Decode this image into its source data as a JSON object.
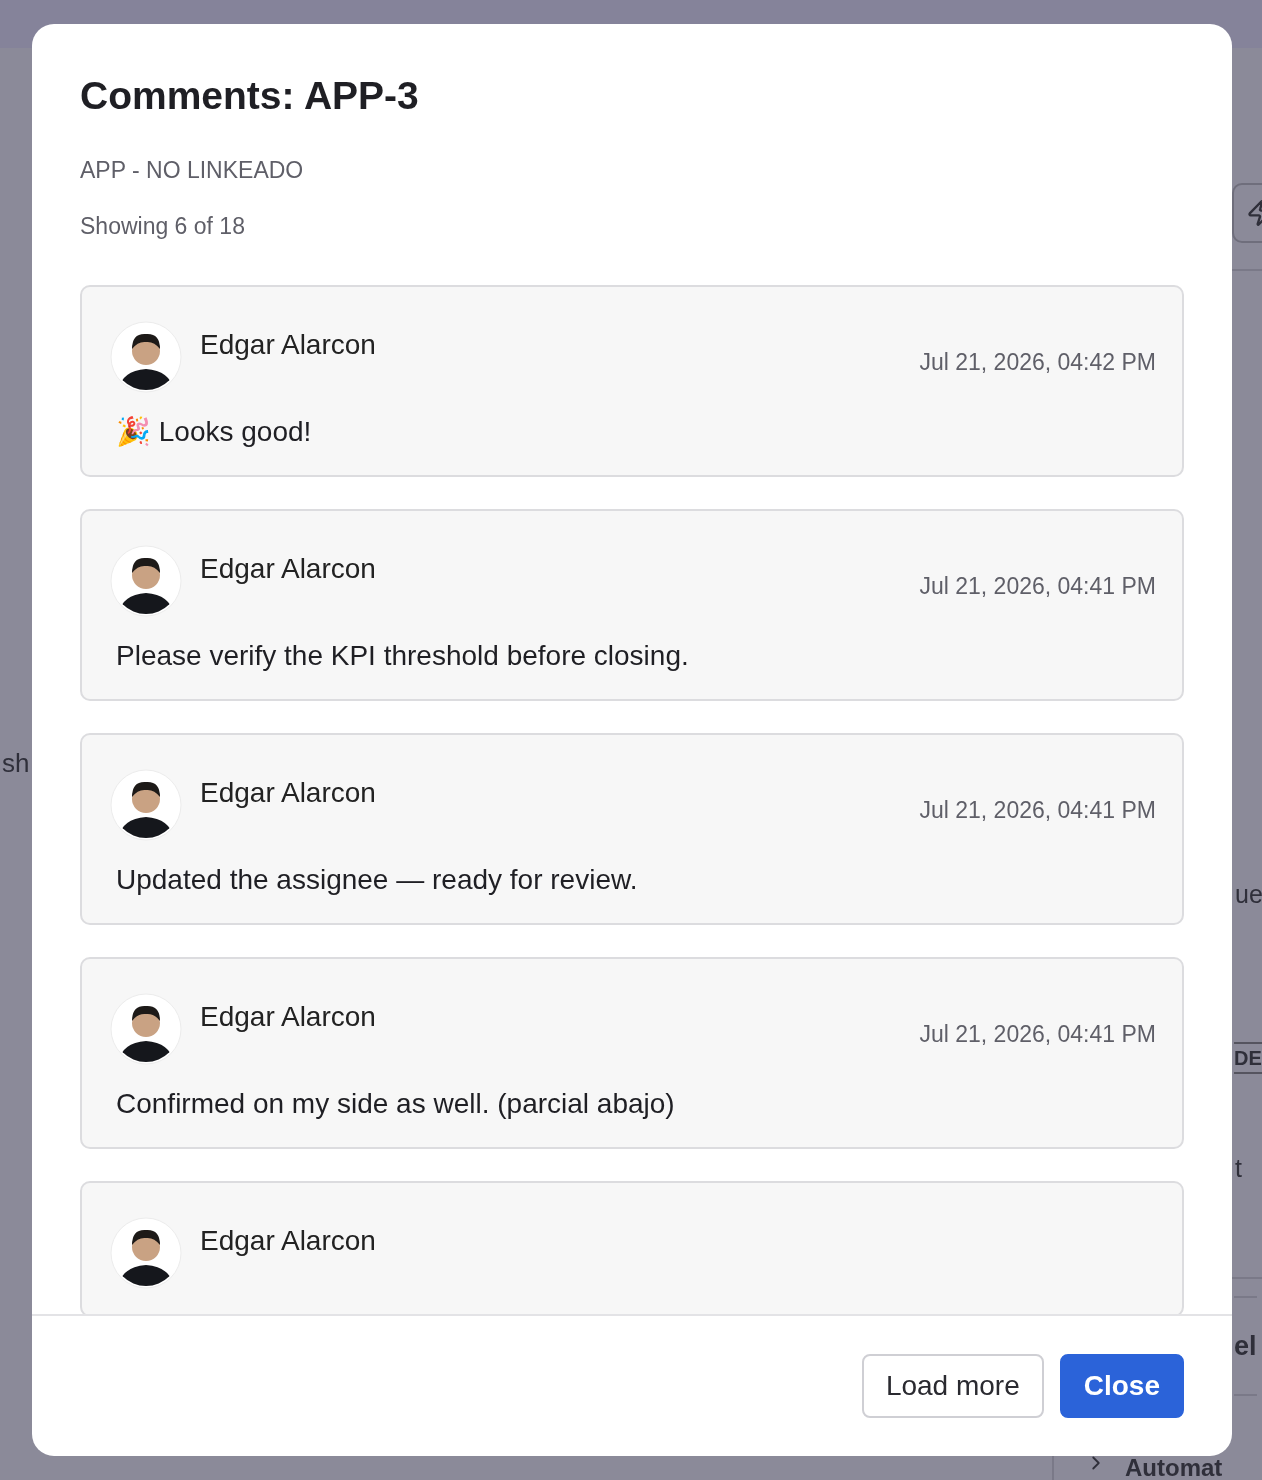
{
  "background": {
    "left_fragment": "sh",
    "right_fragments": [
      {
        "kind": "text",
        "text": "ue"
      },
      {
        "kind": "badge",
        "text": "DE"
      },
      {
        "kind": "text",
        "text": "t"
      },
      {
        "kind": "boxed",
        "text": "el"
      },
      {
        "kind": "row",
        "text": "Automat"
      }
    ]
  },
  "modal": {
    "title": "Comments: APP-3",
    "subtitle": "APP - NO LINKEADO",
    "count": "Showing 6 of 18",
    "comments": [
      {
        "author": "Edgar Alarcon",
        "date": "Jul 21, 2026, 04:42 PM",
        "body": "🎉 Looks good!"
      },
      {
        "author": "Edgar Alarcon",
        "date": "Jul 21, 2026, 04:41 PM",
        "body": "Please verify the KPI threshold before closing."
      },
      {
        "author": "Edgar Alarcon",
        "date": "Jul 21, 2026, 04:41 PM",
        "body": "Updated the assignee — ready for review."
      },
      {
        "author": "Edgar Alarcon",
        "date": "Jul 21, 2026, 04:41 PM",
        "body": "Confirmed on my side as well. (parcial abajo)"
      },
      {
        "author": "Edgar Alarcon"
      }
    ],
    "buttons": [
      {
        "kind": "secondary",
        "label": "Load more"
      },
      {
        "kind": "primary",
        "label": "Close"
      }
    ]
  }
}
